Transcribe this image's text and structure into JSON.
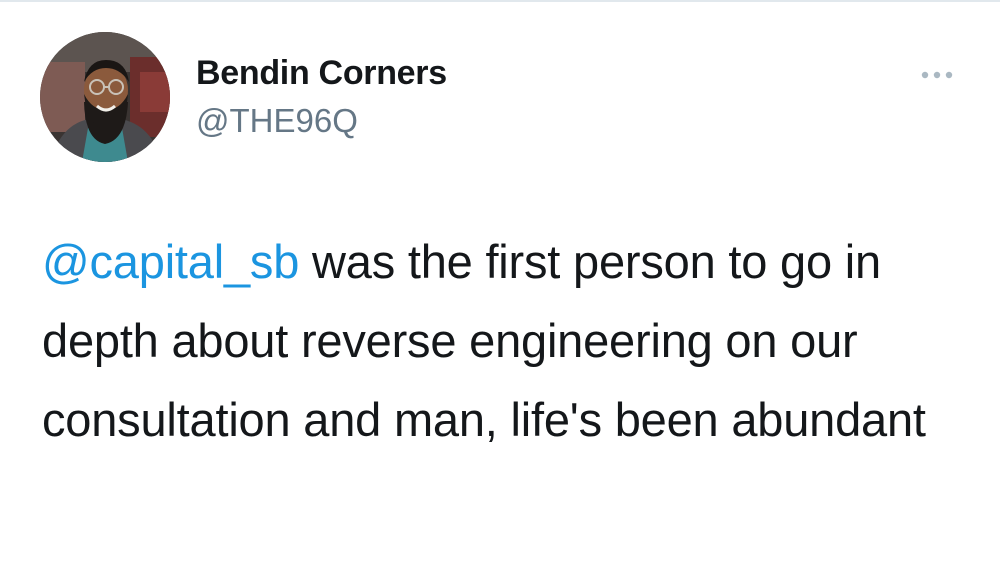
{
  "tweet": {
    "author": {
      "display_name": "Bendin Corners",
      "handle": "@THE96Q",
      "avatar_icon": "user-avatar"
    },
    "more_icon": "more-options-icon",
    "text": {
      "mention": "@capital_sb",
      "body": " was the first person to go in depth about reverse engineering on our consultation and man, life's been abundant"
    }
  },
  "colors": {
    "mention": "#1b95e0",
    "handle": "#657786",
    "text": "#14171a",
    "divider": "#e1e8ed"
  }
}
